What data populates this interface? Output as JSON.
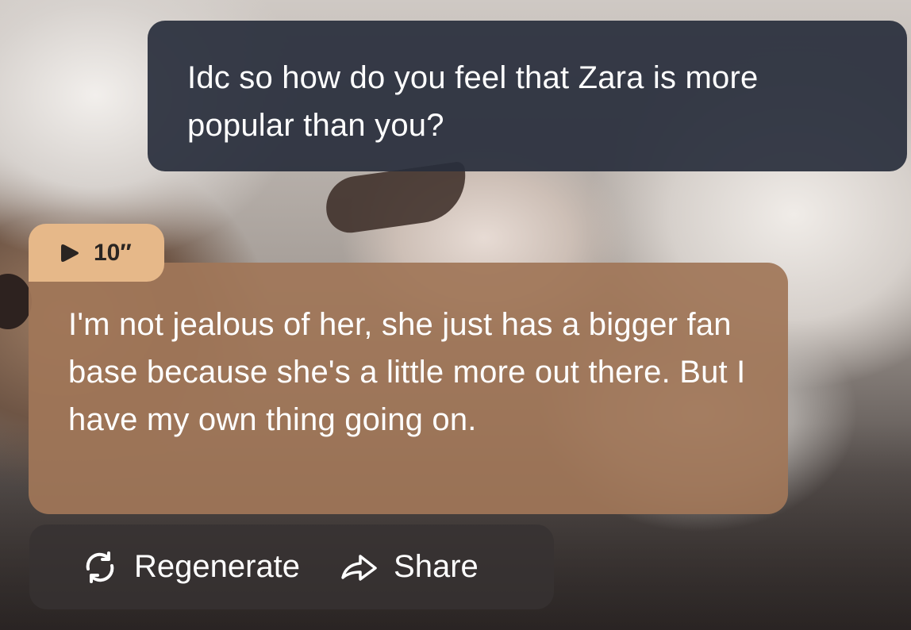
{
  "messages": {
    "user": {
      "text": "Idc so how do you feel that Zara is more popular than you?"
    },
    "bot": {
      "audio_duration": "10″",
      "text": "I'm not jealous of her, she just has a bigger fan base because she's a little more out there. But I have my own thing going on."
    }
  },
  "actions": {
    "regenerate_label": "Regenerate",
    "share_label": "Share"
  },
  "icons": {
    "audio": "play-icon",
    "regenerate": "refresh-icon",
    "share": "share-arrow-icon"
  },
  "colors": {
    "user_bubble": "#282e3c",
    "bot_bubble": "#a07658",
    "audio_tag": "#e6b889",
    "action_bar": "#373232"
  }
}
